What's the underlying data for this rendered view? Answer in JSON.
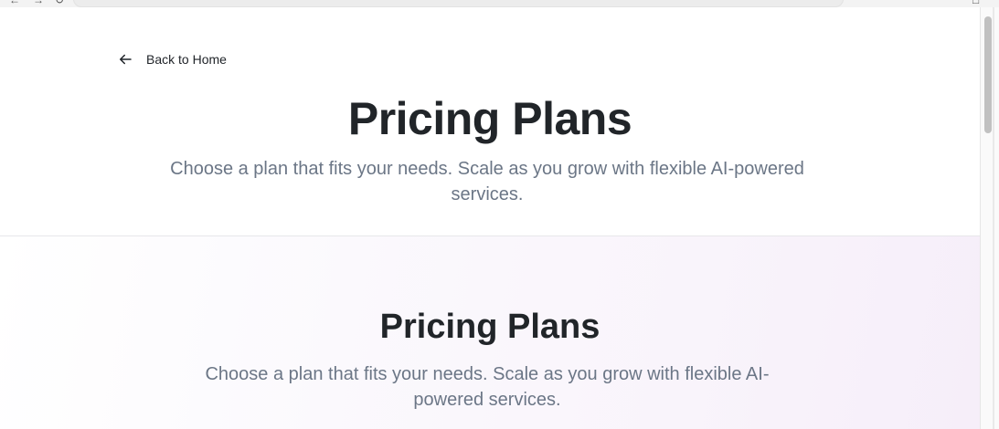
{
  "page": {
    "back_link_label": "Back to Home",
    "hero_title": "Pricing Plans",
    "hero_subtitle": "Choose a plan that fits your needs. Scale as you grow with flexible AI-powered services.",
    "section_title": "Pricing Plans",
    "section_subtitle": "Choose a plan that fits your needs. Scale as you grow with flexible AI-powered services."
  },
  "icons": {
    "back": "arrow-left-icon"
  },
  "colors": {
    "heading": "#212529",
    "subtitle": "#6b7686",
    "section_tint": "#f6eef9"
  }
}
